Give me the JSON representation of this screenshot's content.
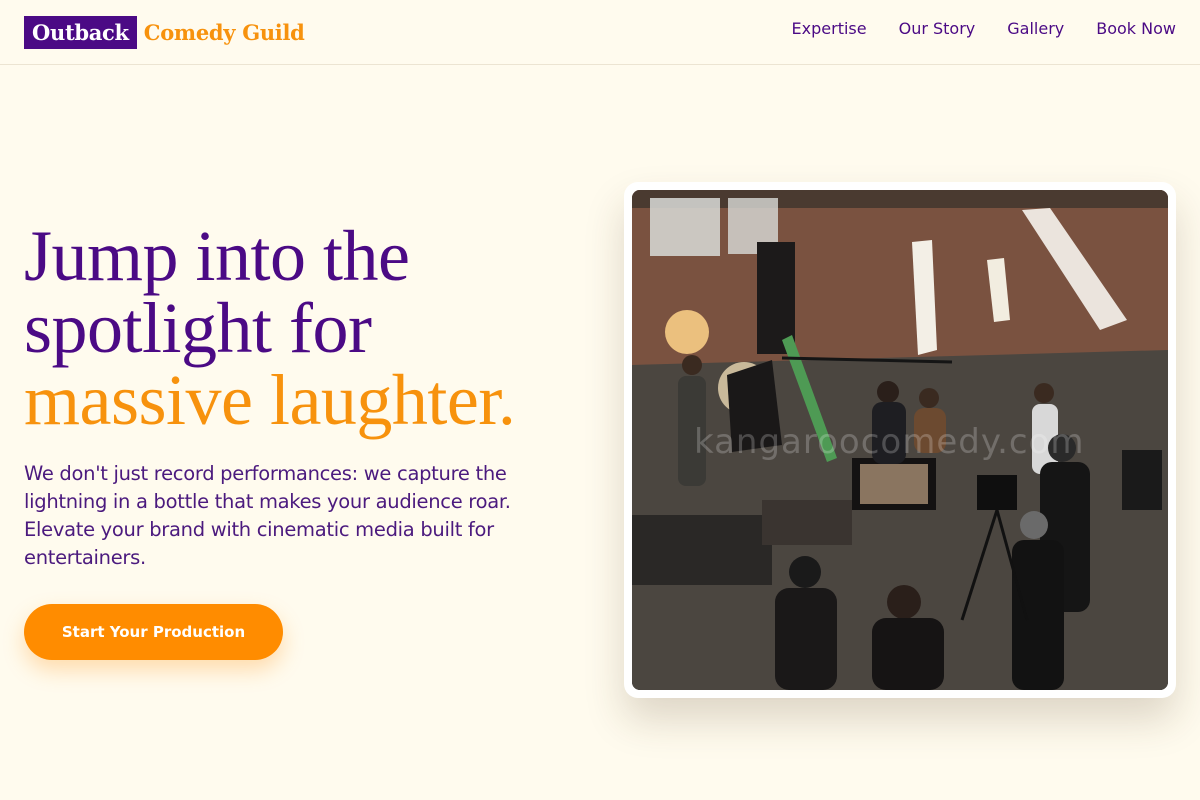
{
  "brand": {
    "box_text": "Outback",
    "text": "Comedy Guild",
    "primary_color": "#4b0a85",
    "accent_color": "#f7920d"
  },
  "nav": {
    "items": [
      {
        "label": "Expertise"
      },
      {
        "label": "Our Story"
      },
      {
        "label": "Gallery"
      },
      {
        "label": "Book Now"
      }
    ]
  },
  "hero": {
    "title_line1": "Jump into the",
    "title_line2": "spotlight for",
    "title_accent": "massive laughter.",
    "subtitle": "We don't just record performances: we capture the lightning in a bottle that makes your audience roar. Elevate your brand with cinematic media built for entertainers.",
    "cta_label": "Start Your Production",
    "cta_color": "#ff8c00"
  },
  "image": {
    "watermark": "kangaroocomedy.com"
  }
}
